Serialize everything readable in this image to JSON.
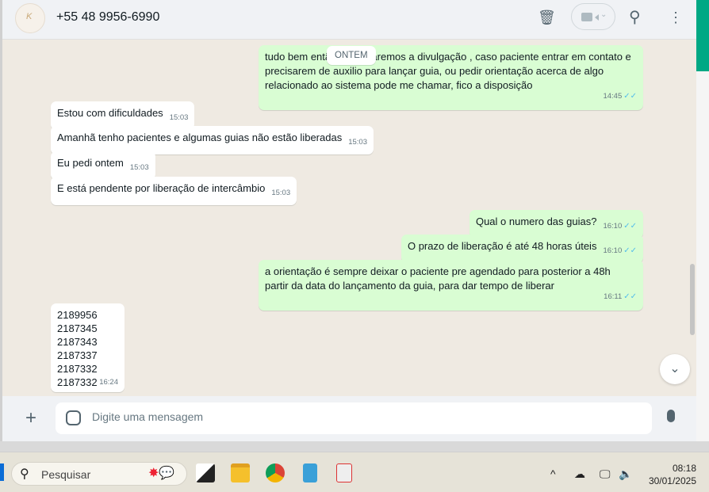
{
  "header": {
    "contact": "+55 48 9956-6990",
    "avatar_text": "K"
  },
  "date_chip": "ONTEM",
  "messages": [
    {
      "dir": "out",
      "text": "tudo bem então, Reativaremos a divulgação , caso paciente entrar em contato e precisarem de auxilio para lançar guia, ou pedir orientação acerca de algo relacionado ao sistema pode me chamar, fico a disposição",
      "time": "14:45"
    },
    {
      "dir": "in",
      "text": "Estou com dificuldades",
      "time": "15:03"
    },
    {
      "dir": "in",
      "text": "Amanhã tenho pacientes e algumas guias não estão liberadas",
      "time": "15:03"
    },
    {
      "dir": "in",
      "text": "Eu pedi ontem",
      "time": "15:03"
    },
    {
      "dir": "in",
      "text": "E está pendente por liberação de intercâmbio",
      "time": "15:03"
    },
    {
      "dir": "out",
      "text": "Qual o numero das guias?",
      "time": "16:10"
    },
    {
      "dir": "out",
      "text": "O prazo de liberação é até 48 horas úteis",
      "time": "16:10"
    },
    {
      "dir": "out",
      "text": "a orientação é sempre deixar o paciente pre agendado para posterior a 48h partir da data do lançamento da guia, para dar tempo de liberar",
      "time": "16:11"
    },
    {
      "dir": "in",
      "lines": [
        "2189956",
        "2187345",
        "2187343",
        "2187337",
        "2187332",
        "2187332"
      ],
      "time": "16:24"
    }
  ],
  "composer": {
    "placeholder": "Digite uma mensagem"
  },
  "taskbar": {
    "search_label": "Pesquisar",
    "time": "08:18",
    "date": "30/01/2025"
  },
  "colors": {
    "outgoing": "#d9fdd3",
    "incoming": "#ffffff",
    "chat_bg": "#efeae2",
    "accent": "#00a884"
  }
}
